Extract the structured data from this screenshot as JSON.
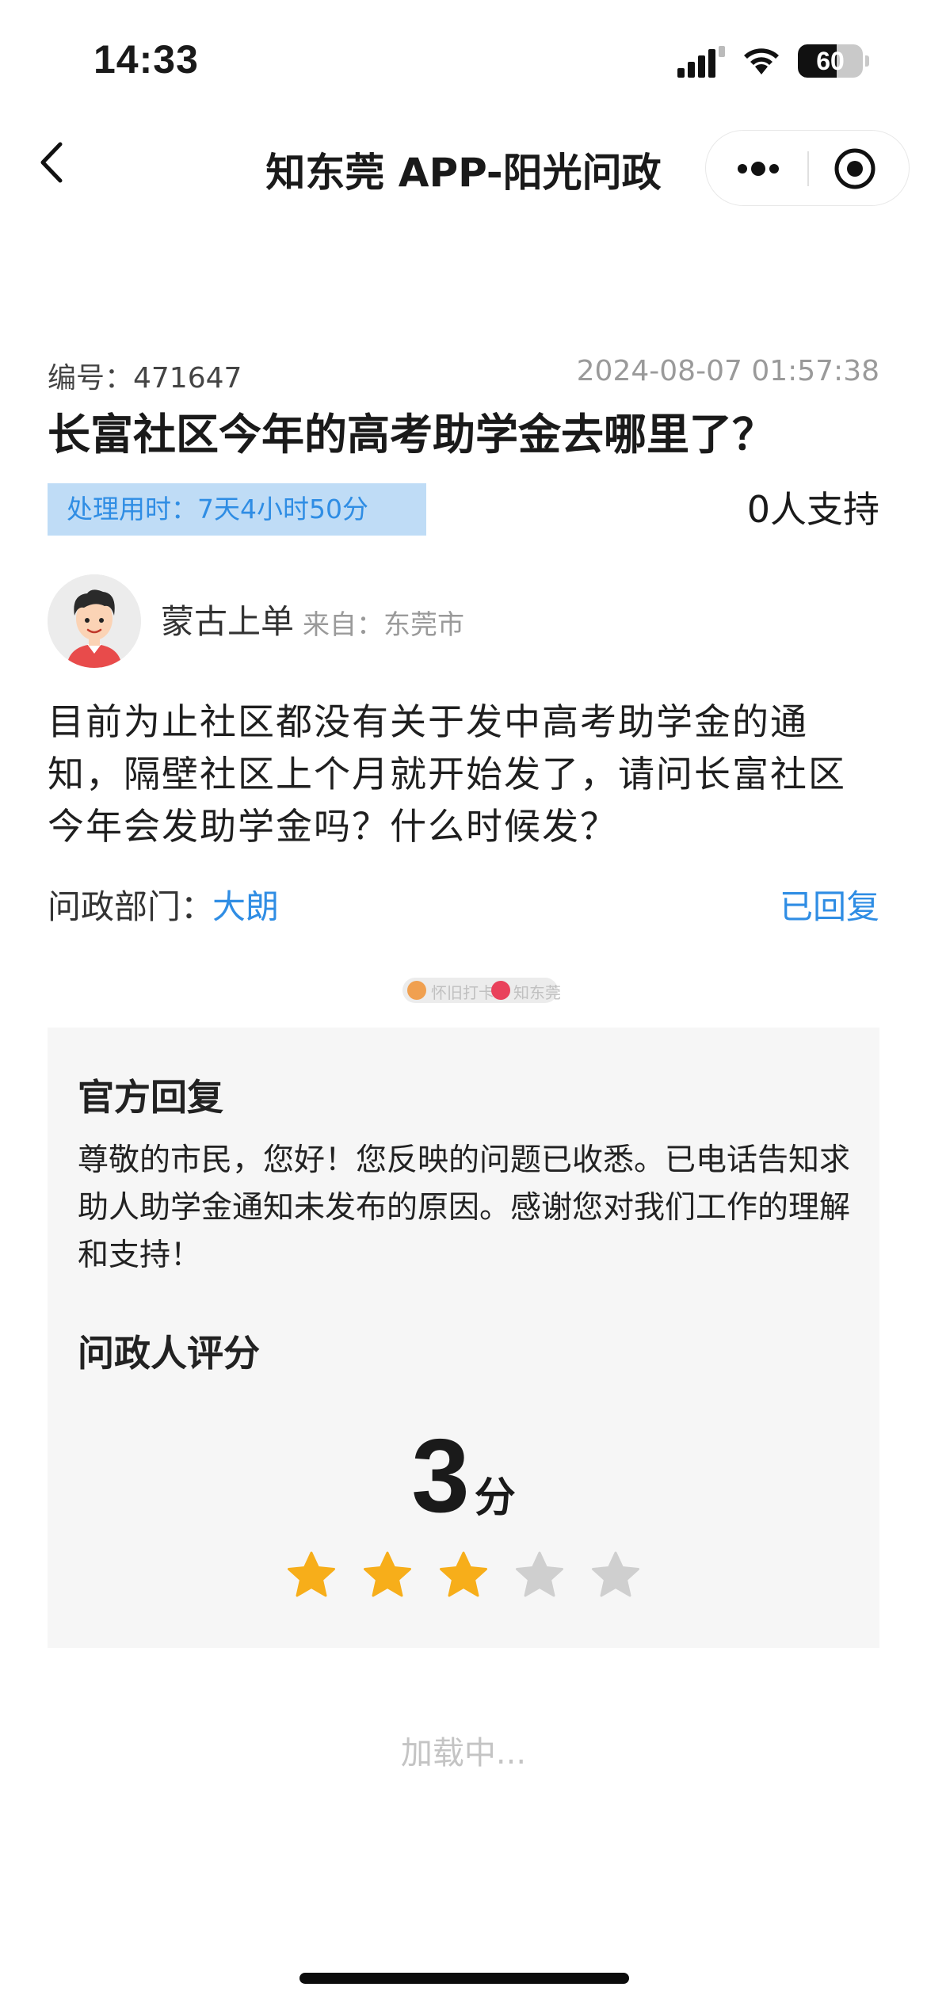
{
  "status_bar": {
    "time": "14:33",
    "battery": "60",
    "battery_level": 0.6,
    "icons": [
      "signal-icon",
      "wifi-icon",
      "battery-icon"
    ]
  },
  "nav": {
    "title": "知东莞 APP-阳光问政",
    "icons": [
      "back-arrow-icon",
      "more-dots-icon",
      "close-target-icon"
    ]
  },
  "question": {
    "serial": "编号：471647",
    "datetime": "2024-08-07 01:57:38",
    "title": "长富社区今年的高考助学金去哪里了？",
    "processing_time": "处理用时：7天4小时50分",
    "supporters": "0人支持",
    "author": "蒙古上单",
    "from": "来自：东莞市",
    "body": "目前为止社区都没有关于发中高考助学金的通知，隔壁社区上个月就开始发了，请问长富社区今年会发助学金吗？什么时候发？",
    "department_label": "问政部门：",
    "department": "大朗",
    "status": "已回复"
  },
  "watermark": {
    "left_text": "怀旧打卡",
    "right_text": "知东莞"
  },
  "reply": {
    "heading": "官方回复",
    "text": "尊敬的市民，您好！您反映的问题已收悉。已电话告知求助人助学金通知未发布的原因。感谢您对我们工作的理解和支持！",
    "rating_heading": "问政人评分",
    "score": "3",
    "score_unit": "分",
    "stars_filled": 3,
    "stars_total": 5,
    "star_color": "#F7AE1A",
    "star_empty_color": "#CFCFCF"
  },
  "loading_text": "加载中...",
  "colors": {
    "accent_blue": "#2F8DE4",
    "badge_bg": "#BFDCF6",
    "card_bg": "#F6F6F6"
  }
}
